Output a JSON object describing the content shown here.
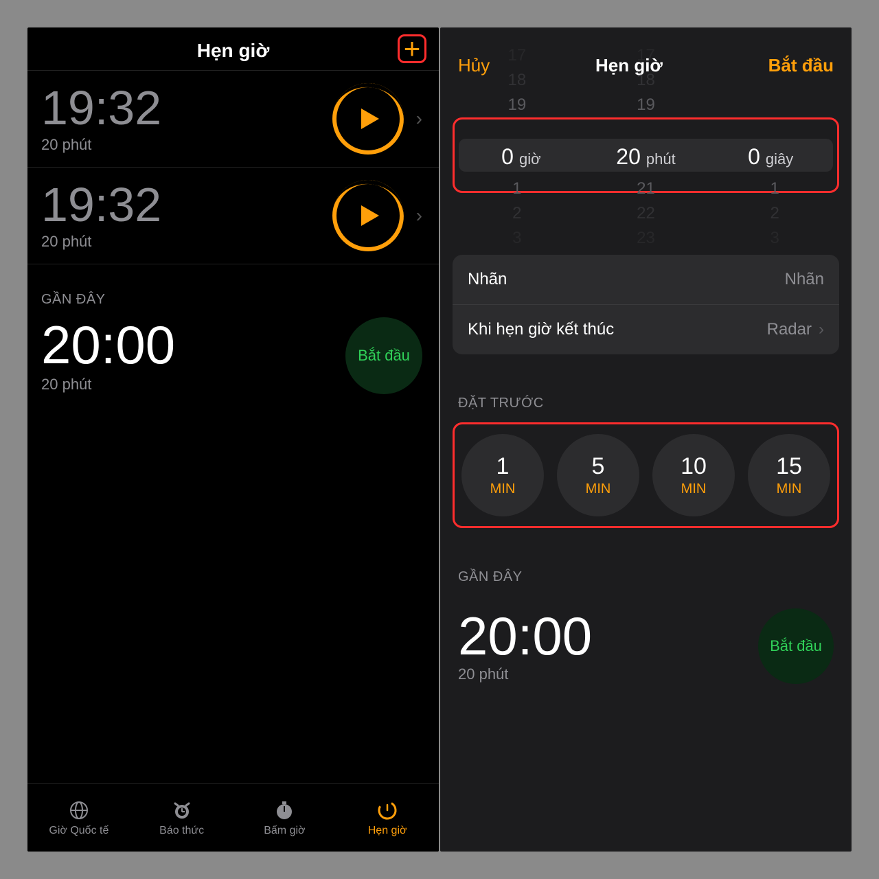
{
  "left": {
    "title": "Hẹn giờ",
    "timers": [
      {
        "time": "19:32",
        "sub": "20 phút"
      },
      {
        "time": "19:32",
        "sub": "20 phút"
      }
    ],
    "recent_header": "GẦN ĐÂY",
    "recent": {
      "time": "20:00",
      "sub": "20 phút",
      "start": "Bắt đầu"
    },
    "tabs": {
      "world": "Giờ Quốc tế",
      "alarm": "Báo thức",
      "stopwatch": "Bấm giờ",
      "timer": "Hẹn giờ"
    }
  },
  "right": {
    "cancel": "Hủy",
    "title": "Hẹn giờ",
    "start": "Bắt đầu",
    "picker": {
      "hours_above": [
        "17",
        "18",
        "19"
      ],
      "minutes_above": [
        "17",
        "18",
        "19"
      ],
      "seconds_above": [
        "",
        "",
        ""
      ],
      "hours": "0",
      "hours_label": "giờ",
      "minutes": "20",
      "minutes_label": "phút",
      "seconds": "0",
      "seconds_label": "giây",
      "hours_below": [
        "1",
        "2",
        "3"
      ],
      "minutes_below": [
        "21",
        "22",
        "23"
      ],
      "seconds_below": [
        "1",
        "2",
        "3"
      ]
    },
    "label_row": {
      "label": "Nhãn",
      "value": "Nhãn"
    },
    "end_row": {
      "label": "Khi hẹn giờ kết thúc",
      "value": "Radar"
    },
    "presets_header": "ĐẶT TRƯỚC",
    "presets": [
      {
        "n": "1",
        "u": "MIN"
      },
      {
        "n": "5",
        "u": "MIN"
      },
      {
        "n": "10",
        "u": "MIN"
      },
      {
        "n": "15",
        "u": "MIN"
      }
    ],
    "recent_header": "GẦN ĐÂY",
    "recent": {
      "time": "20:00",
      "sub": "20 phút",
      "start": "Bắt đầu"
    }
  }
}
